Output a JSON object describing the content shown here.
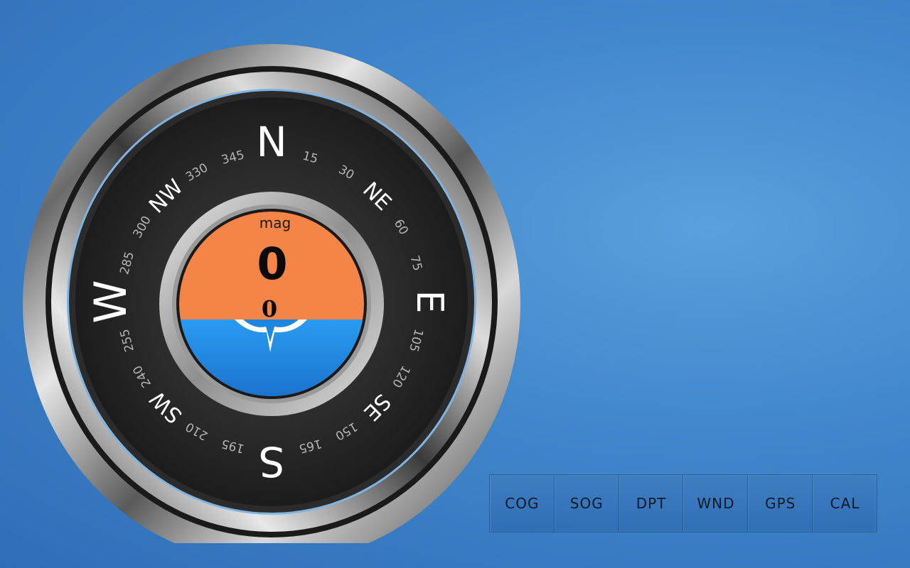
{
  "compass": {
    "unit_label": "mag",
    "heading_value": "0",
    "secondary_value": "0",
    "cardinals": [
      "N",
      "NE",
      "E",
      "SE",
      "S",
      "SW",
      "W",
      "NW"
    ],
    "degree_ticks": [
      "15",
      "30",
      "60",
      "75",
      "105",
      "120",
      "150",
      "165",
      "195",
      "210",
      "240",
      "255",
      "285",
      "300",
      "330",
      "345"
    ],
    "heading_deg": 0
  },
  "nav": {
    "buttons": [
      {
        "label": "COG"
      },
      {
        "label": "SOG"
      },
      {
        "label": "DPT"
      },
      {
        "label": "WND"
      },
      {
        "label": "GPS"
      },
      {
        "label": "CAL"
      }
    ]
  },
  "colors": {
    "face_orange": "#f58447",
    "water_blue": "#1f86e0",
    "dial_dark": "#262626"
  }
}
